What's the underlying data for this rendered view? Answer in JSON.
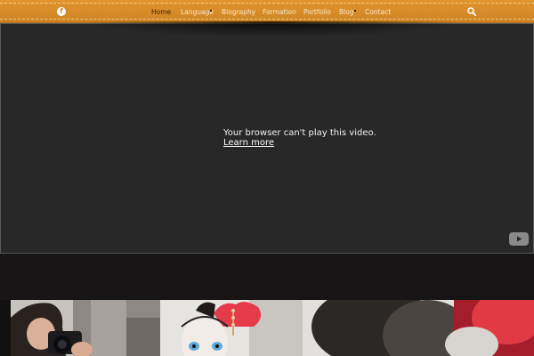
{
  "header": {
    "social_icon": "facebook-icon",
    "nav": [
      {
        "label": "Home",
        "active": true
      },
      {
        "label": "Language",
        "has_submenu": true
      },
      {
        "label": "Biography"
      },
      {
        "label": "Formation"
      },
      {
        "label": "Portfolio"
      },
      {
        "label": "Blog",
        "has_submenu": true
      },
      {
        "label": "Contact"
      }
    ],
    "search_icon": "search-icon",
    "accent_color": "#d68a29"
  },
  "video": {
    "message": "Your browser can't play this video.",
    "link_label": "Learn more",
    "logo_icon": "youtube-icon"
  },
  "gallery": {
    "photos": [
      "photographer-with-camera",
      "clown-performer-with-feathers",
      "blurred-portrait-red-feathers"
    ]
  }
}
